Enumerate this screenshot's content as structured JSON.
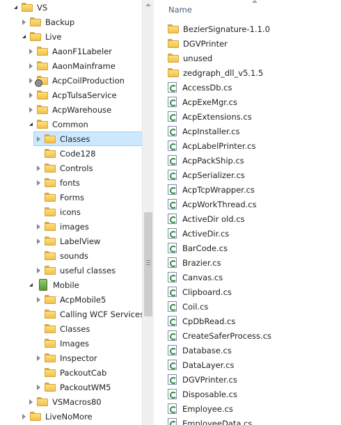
{
  "tree": {
    "items": [
      {
        "label": "VS",
        "state": "expanded",
        "icon": "folder-icon"
      },
      {
        "label": "Backup",
        "state": "collapsed",
        "icon": "folder-icon"
      },
      {
        "label": "Live",
        "state": "expanded",
        "icon": "folder-icon"
      },
      {
        "label": "AaonF1Labeler",
        "state": "collapsed",
        "icon": "folder-icon"
      },
      {
        "label": "AaonMainframe",
        "state": "collapsed",
        "icon": "folder-icon"
      },
      {
        "label": "AcpCoilProduction",
        "state": "collapsed",
        "icon": "gear-folder-icon"
      },
      {
        "label": "AcpTulsaService",
        "state": "collapsed",
        "icon": "folder-icon"
      },
      {
        "label": "AcpWarehouse",
        "state": "collapsed",
        "icon": "folder-icon"
      },
      {
        "label": "Common",
        "state": "expanded",
        "icon": "folder-icon"
      },
      {
        "label": "Classes",
        "state": "collapsed",
        "icon": "folder-icon",
        "selected": true
      },
      {
        "label": "Code128",
        "state": "none",
        "icon": "folder-icon"
      },
      {
        "label": "Controls",
        "state": "collapsed",
        "icon": "folder-icon"
      },
      {
        "label": "fonts",
        "state": "collapsed",
        "icon": "folder-icon"
      },
      {
        "label": "Forms",
        "state": "none",
        "icon": "folder-icon"
      },
      {
        "label": "icons",
        "state": "none",
        "icon": "folder-icon"
      },
      {
        "label": "images",
        "state": "collapsed",
        "icon": "folder-icon"
      },
      {
        "label": "LabelView",
        "state": "collapsed",
        "icon": "folder-icon"
      },
      {
        "label": "sounds",
        "state": "none",
        "icon": "folder-icon"
      },
      {
        "label": "useful classes",
        "state": "collapsed",
        "icon": "folder-icon"
      },
      {
        "label": "Mobile",
        "state": "expanded",
        "icon": "mobile-project-icon"
      },
      {
        "label": "AcpMobile5",
        "state": "collapsed",
        "icon": "folder-icon"
      },
      {
        "label": "Calling WCF Services",
        "state": "none",
        "icon": "folder-icon"
      },
      {
        "label": "Classes",
        "state": "none",
        "icon": "folder-icon"
      },
      {
        "label": "Images",
        "state": "none",
        "icon": "folder-icon"
      },
      {
        "label": "Inspector",
        "state": "collapsed",
        "icon": "folder-icon"
      },
      {
        "label": "PackoutCab",
        "state": "none",
        "icon": "folder-icon"
      },
      {
        "label": "PackoutWM5",
        "state": "collapsed",
        "icon": "folder-icon"
      },
      {
        "label": "VSMacros80",
        "state": "collapsed",
        "icon": "folder-icon"
      },
      {
        "label": "LiveNoMore",
        "state": "collapsed",
        "icon": "folder-icon"
      }
    ]
  },
  "list": {
    "column_name": "Name",
    "files": [
      {
        "name": "BezierSignature-1.1.0",
        "type": "folder"
      },
      {
        "name": "DGVPrinter",
        "type": "folder"
      },
      {
        "name": "unused",
        "type": "folder"
      },
      {
        "name": "zedgraph_dll_v5.1.5",
        "type": "folder"
      },
      {
        "name": "AccessDb.cs",
        "type": "cs"
      },
      {
        "name": "AcpExeMgr.cs",
        "type": "cs"
      },
      {
        "name": "AcpExtensions.cs",
        "type": "cs"
      },
      {
        "name": "AcpInstaller.cs",
        "type": "cs"
      },
      {
        "name": "AcpLabelPrinter.cs",
        "type": "cs"
      },
      {
        "name": "AcpPackShip.cs",
        "type": "cs"
      },
      {
        "name": "AcpSerializer.cs",
        "type": "cs"
      },
      {
        "name": "AcpTcpWrapper.cs",
        "type": "cs"
      },
      {
        "name": "AcpWorkThread.cs",
        "type": "cs"
      },
      {
        "name": "ActiveDir old.cs",
        "type": "cs"
      },
      {
        "name": "ActiveDir.cs",
        "type": "cs"
      },
      {
        "name": "BarCode.cs",
        "type": "cs"
      },
      {
        "name": "Brazier.cs",
        "type": "cs"
      },
      {
        "name": "Canvas.cs",
        "type": "cs"
      },
      {
        "name": "Clipboard.cs",
        "type": "cs"
      },
      {
        "name": "Coil.cs",
        "type": "cs"
      },
      {
        "name": "CpDbRead.cs",
        "type": "cs"
      },
      {
        "name": "CreateSaferProcess.cs",
        "type": "cs"
      },
      {
        "name": "Database.cs",
        "type": "cs"
      },
      {
        "name": "DataLayer.cs",
        "type": "cs"
      },
      {
        "name": "DGVPrinter.cs",
        "type": "cs"
      },
      {
        "name": "Disposable.cs",
        "type": "cs"
      },
      {
        "name": "Employee.cs",
        "type": "cs"
      },
      {
        "name": "EmployeeData.cs",
        "type": "cs"
      }
    ]
  }
}
